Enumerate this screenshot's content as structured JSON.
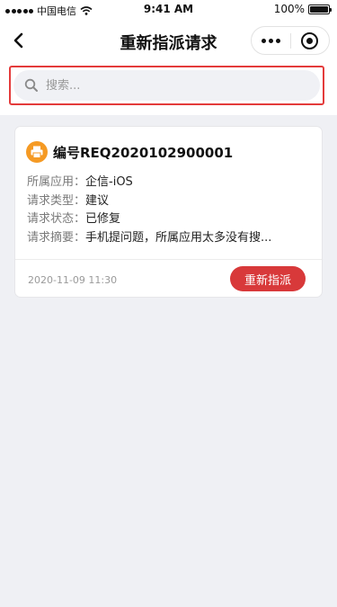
{
  "status_bar": {
    "carrier": "中国电信",
    "time": "9:41 AM",
    "battery": "100%",
    "battery_level": 1.0
  },
  "nav": {
    "title": "重新指派请求",
    "back_icon": "chevron-left-icon",
    "more_icon": "more-dots-icon",
    "target_icon": "target-icon"
  },
  "search": {
    "placeholder": "搜索...",
    "value": "",
    "highlight_color": "#e43b3b"
  },
  "cards": [
    {
      "icon": "printer-icon",
      "icon_color": "#f59a24",
      "title": "编号REQ2020102900001",
      "fields": [
        {
          "label": "所属应用：",
          "value": "企信-iOS"
        },
        {
          "label": "请求类型：",
          "value": "建议"
        },
        {
          "label": "请求状态：",
          "value": "已修复"
        },
        {
          "label": "请求摘要：",
          "value": "手机提问题，所属应用太多没有搜..."
        }
      ],
      "timestamp": "2020-11-09  11:30",
      "action_label": "重新指派",
      "action_color": "#d8393a"
    }
  ]
}
